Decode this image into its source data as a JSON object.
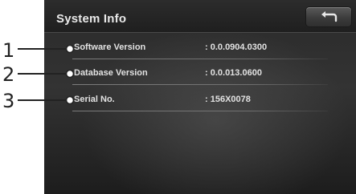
{
  "header": {
    "title": "System Info"
  },
  "info_rows": [
    {
      "label": "Software Version",
      "value": ": 0.0.0904.0300"
    },
    {
      "label": "Database Version",
      "value": ": 0.0.013.0600"
    },
    {
      "label": "Serial No.",
      "value": ": 156X0078"
    }
  ],
  "callouts": [
    "1",
    "2",
    "3"
  ],
  "icons": {
    "back": "return-arrow-icon"
  },
  "colors": {
    "screen_background": "#2a2a2a",
    "text": "#e2e2e2",
    "callout": "#222222"
  }
}
